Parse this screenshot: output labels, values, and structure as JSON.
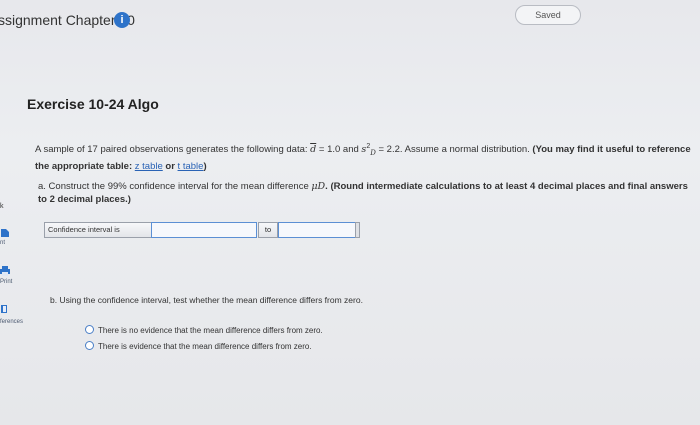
{
  "header": {
    "assignment_title": "ssignment Chapter 10",
    "info_icon": "info-icon",
    "saved_label": "Saved"
  },
  "sidebar": {
    "top_label": "k",
    "items": [
      {
        "label": "nt",
        "icon": "document-icon"
      },
      {
        "label": "Print",
        "icon": "printer-icon"
      },
      {
        "label": "ferences",
        "icon": "book-icon"
      }
    ]
  },
  "exercise": {
    "title": "Exercise 10-24 Algo",
    "intro_text_1": "A sample of 17 paired observations generates the following data: ",
    "d_bar": "d",
    "d_value": " = 1.0 and ",
    "s_sym": "s",
    "s_sup": "2",
    "s_sub": "D",
    "s_value": " = 2.2. Assume a normal distribution. ",
    "intro_bold": "(You may find it useful to reference the appropriate table: ",
    "z_table": "z table",
    "or_text": " or ",
    "t_table": "t table",
    "close_paren": ")",
    "part_a_prefix": "a. Construct the 99% confidence interval for the mean difference ",
    "mu_d": "μD",
    "part_a_bold": ". (Round intermediate calculations to at least 4 decimal places and final answers to 2 decimal places.)",
    "ci_label": "Confidence interval is",
    "ci_to": "to",
    "ci_lower": "",
    "ci_upper": "",
    "part_b": "b. Using the confidence interval, test whether the mean difference differs from zero.",
    "options": [
      "There is no evidence that the mean difference differs from zero.",
      "There is evidence that the mean difference differs from zero."
    ]
  },
  "colors": {
    "info_icon_bg": "#2e73c9",
    "link": "#2a63b5",
    "input_border": "#5b8fd4",
    "background": "#e7e8ec"
  }
}
